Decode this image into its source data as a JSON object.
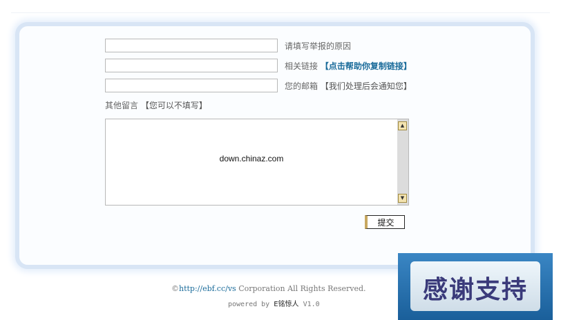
{
  "form": {
    "reason_hint": "请填写举报的原因",
    "link_hint": "相关链接",
    "link_help": "【点击帮助你复制链接】",
    "email_hint": "您的邮箱",
    "email_note": "【我们处理后会通知您】",
    "memo_label": "其他留言",
    "memo_note": "【您可以不填写】",
    "memo_text": "down.chinaz.com",
    "submit_label": "提交"
  },
  "footer": {
    "copyright_symbol": "©",
    "url": "http://ebf.cc/vs",
    "rights": " Corporation All Rights Reserved.",
    "powered_prefix": "powered by ",
    "brand": "E铭惊人",
    "version": " V1.0"
  },
  "promo": {
    "text": "感谢支持"
  }
}
